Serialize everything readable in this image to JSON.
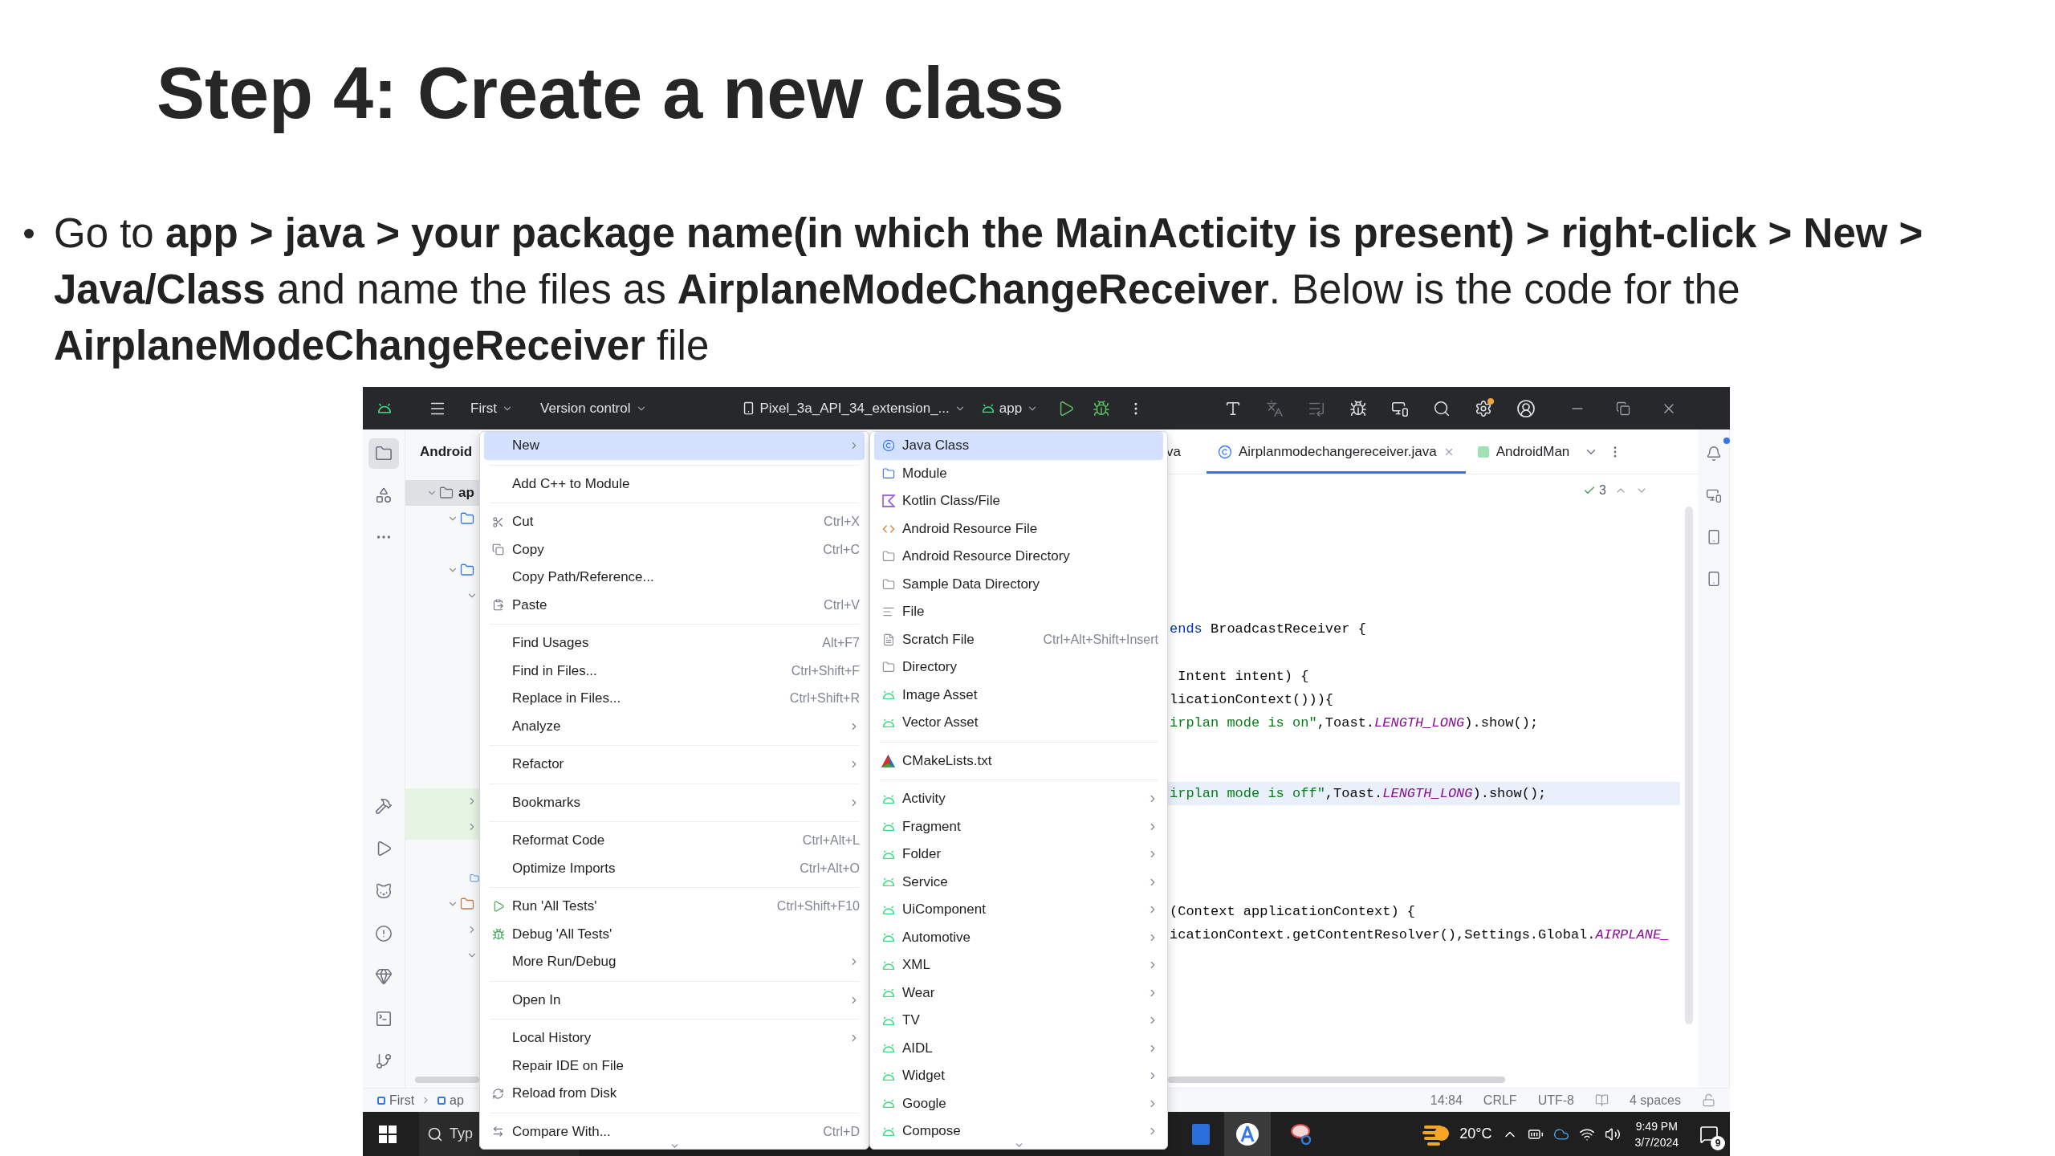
{
  "slide": {
    "title": "Step 4: Create a new class",
    "bullet_text": "Go to **app > java > your package name(in which the MainActicity is present) > right-click > New > Java/Class** and name the files as **AirplaneModeChangeReceiver**. Below is the code for the **AirplaneModeChangeReceiver** file"
  },
  "ide": {
    "toolbar": {
      "project": "First",
      "vcs": "Version control",
      "device": "Pixel_3a_API_34_extension_...",
      "run_config": "app"
    },
    "project_panel": {
      "header": "Android",
      "root": {
        "label": "ap",
        "selected": true
      }
    },
    "tabs": [
      {
        "label": "va",
        "selected": false
      },
      {
        "label": "Airplanmodechangereceiver.java",
        "selected": true
      },
      {
        "label": "AndroidMan",
        "selected": false
      }
    ],
    "inspections": {
      "count": "3"
    },
    "code_lines": [
      {
        "caret_line": false,
        "tokens": [
          {
            "kind": "keyword",
            "text": "ends"
          },
          {
            "kind": "plain",
            "text": " BroadcastReceiver {"
          }
        ]
      },
      {
        "caret_line": false,
        "tokens": [
          {
            "kind": "plain",
            "text": " Intent intent) {"
          }
        ]
      },
      {
        "caret_line": false,
        "tokens": [
          {
            "kind": "plain",
            "text": "licationContext())){"
          }
        ]
      },
      {
        "caret_line": false,
        "tokens": [
          {
            "kind": "string",
            "text": "irplan mode is on\""
          },
          {
            "kind": "plain",
            "text": ",Toast."
          },
          {
            "kind": "constant",
            "text": "LENGTH_LONG"
          },
          {
            "kind": "plain",
            "text": ").show();"
          }
        ]
      },
      {
        "caret_line": true,
        "tokens": [
          {
            "kind": "string",
            "text": "irplan mode is off\""
          },
          {
            "kind": "plain",
            "text": ",Toast."
          },
          {
            "kind": "constant",
            "text": "LENGTH_LONG"
          },
          {
            "kind": "plain",
            "text": ").show();"
          }
        ]
      },
      {
        "caret_line": false,
        "tokens": [
          {
            "kind": "plain",
            "text": "(Context applicationContext) {"
          }
        ]
      },
      {
        "caret_line": false,
        "tokens": [
          {
            "kind": "plain",
            "text": "icationContext.getContentResolver(),Settings.Global."
          },
          {
            "kind": "constant",
            "text": "AIRPLANE_"
          }
        ]
      }
    ],
    "context_menu": {
      "groups": [
        [
          {
            "label": "New",
            "submenu": true,
            "selected": true
          }
        ],
        [
          {
            "label": "Add C++ to Module",
            "submenu": false,
            "selected": false
          }
        ],
        [
          {
            "label": "Cut",
            "shortcut": "Ctrl+X",
            "submenu": false,
            "selected": false
          },
          {
            "label": "Copy",
            "shortcut": "Ctrl+C",
            "submenu": false,
            "selected": false
          },
          {
            "label": "Copy Path/Reference...",
            "submenu": false,
            "selected": false
          },
          {
            "label": "Paste",
            "shortcut": "Ctrl+V",
            "submenu": false,
            "selected": false
          }
        ],
        [
          {
            "label": "Find Usages",
            "shortcut": "Alt+F7",
            "submenu": false,
            "selected": false
          },
          {
            "label": "Find in Files...",
            "shortcut": "Ctrl+Shift+F",
            "submenu": false,
            "selected": false
          },
          {
            "label": "Replace in Files...",
            "shortcut": "Ctrl+Shift+R",
            "submenu": false,
            "selected": false
          },
          {
            "label": "Analyze",
            "submenu": true,
            "selected": false
          }
        ],
        [
          {
            "label": "Refactor",
            "submenu": true,
            "selected": false
          }
        ],
        [
          {
            "label": "Bookmarks",
            "submenu": true,
            "selected": false
          }
        ],
        [
          {
            "label": "Reformat Code",
            "shortcut": "Ctrl+Alt+L",
            "submenu": false,
            "selected": false
          },
          {
            "label": "Optimize Imports",
            "shortcut": "Ctrl+Alt+O",
            "submenu": false,
            "selected": false
          }
        ],
        [
          {
            "label": "Run 'All Tests'",
            "shortcut": "Ctrl+Shift+F10",
            "submenu": false,
            "selected": false
          },
          {
            "label": "Debug 'All Tests'",
            "submenu": false,
            "selected": false
          },
          {
            "label": "More Run/Debug",
            "submenu": true,
            "selected": false
          }
        ],
        [
          {
            "label": "Open In",
            "submenu": true,
            "selected": false
          }
        ],
        [
          {
            "label": "Local History",
            "submenu": true,
            "selected": false
          },
          {
            "label": "Repair IDE on File",
            "submenu": false,
            "selected": false
          },
          {
            "label": "Reload from Disk",
            "submenu": false,
            "selected": false
          }
        ],
        [
          {
            "label": "Compare With...",
            "shortcut": "Ctrl+D",
            "submenu": false,
            "selected": false
          }
        ]
      ]
    },
    "new_submenu": {
      "groups": [
        [
          {
            "label": "Java Class",
            "submenu": false,
            "selected": true
          },
          {
            "label": "Module",
            "submenu": false,
            "selected": false
          },
          {
            "label": "Kotlin Class/File",
            "submenu": false,
            "selected": false
          },
          {
            "label": "Android Resource File",
            "submenu": false,
            "selected": false
          },
          {
            "label": "Android Resource Directory",
            "submenu": false,
            "selected": false
          },
          {
            "label": "Sample Data Directory",
            "submenu": false,
            "selected": false
          },
          {
            "label": "File",
            "submenu": false,
            "selected": false
          },
          {
            "label": "Scratch File",
            "shortcut": "Ctrl+Alt+Shift+Insert",
            "submenu": false,
            "selected": false
          },
          {
            "label": "Directory",
            "submenu": false,
            "selected": false
          },
          {
            "label": "Image Asset",
            "submenu": false,
            "selected": false
          },
          {
            "label": "Vector Asset",
            "submenu": false,
            "selected": false
          }
        ],
        [
          {
            "label": "CMakeLists.txt",
            "submenu": false,
            "selected": false
          }
        ],
        [
          {
            "label": "Activity",
            "submenu": true,
            "selected": false
          },
          {
            "label": "Fragment",
            "submenu": true,
            "selected": false
          },
          {
            "label": "Folder",
            "submenu": true,
            "selected": false
          },
          {
            "label": "Service",
            "submenu": true,
            "selected": false
          },
          {
            "label": "UiComponent",
            "submenu": true,
            "selected": false
          },
          {
            "label": "Automotive",
            "submenu": true,
            "selected": false
          },
          {
            "label": "XML",
            "submenu": true,
            "selected": false
          },
          {
            "label": "Wear",
            "submenu": true,
            "selected": false
          },
          {
            "label": "TV",
            "submenu": true,
            "selected": false
          },
          {
            "label": "AIDL",
            "submenu": true,
            "selected": false
          },
          {
            "label": "Widget",
            "submenu": true,
            "selected": false
          },
          {
            "label": "Google",
            "submenu": true,
            "selected": false
          },
          {
            "label": "Compose",
            "submenu": true,
            "selected": false
          }
        ]
      ]
    },
    "status_bar": {
      "breadcrumb": [
        "First",
        "ap"
      ],
      "position": "14:84",
      "line_separator": "CRLF",
      "encoding": "UTF-8",
      "indent": "4 spaces"
    }
  },
  "taskbar": {
    "search": "Typ",
    "temperature": "20°C",
    "time": "9:49 PM",
    "date": "3/7/2024",
    "notifications": "9"
  }
}
